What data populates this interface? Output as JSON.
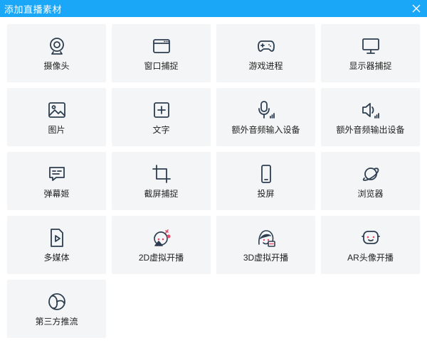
{
  "window": {
    "title": "添加直播素材"
  },
  "colors": {
    "titlebar": "#1aa7f7",
    "tile_bg": "#f4f5f6",
    "icon_stroke": "#2d3e50",
    "text": "#222222"
  },
  "tiles": [
    {
      "label": "摄像头",
      "icon": "webcam-icon"
    },
    {
      "label": "窗口捕捉",
      "icon": "window-icon"
    },
    {
      "label": "游戏进程",
      "icon": "gamepad-icon"
    },
    {
      "label": "显示器捕捉",
      "icon": "monitor-icon"
    },
    {
      "label": "图片",
      "icon": "image-icon"
    },
    {
      "label": "文字",
      "icon": "text-add-icon"
    },
    {
      "label": "额外音频输入设备",
      "icon": "microphone-icon"
    },
    {
      "label": "额外音频输出设备",
      "icon": "speaker-icon"
    },
    {
      "label": "弹幕姬",
      "icon": "danmaku-icon"
    },
    {
      "label": "截屏捕捉",
      "icon": "crop-icon"
    },
    {
      "label": "投屏",
      "icon": "phone-icon"
    },
    {
      "label": "浏览器",
      "icon": "planet-icon"
    },
    {
      "label": "多媒体",
      "icon": "media-file-icon"
    },
    {
      "label": "2D虚拟开播",
      "icon": "avatar-2d-icon"
    },
    {
      "label": "3D虚拟开播",
      "icon": "avatar-3d-icon"
    },
    {
      "label": "AR头像开播",
      "icon": "ar-face-icon"
    },
    {
      "label": "第三方推流",
      "icon": "aperture-icon"
    }
  ]
}
